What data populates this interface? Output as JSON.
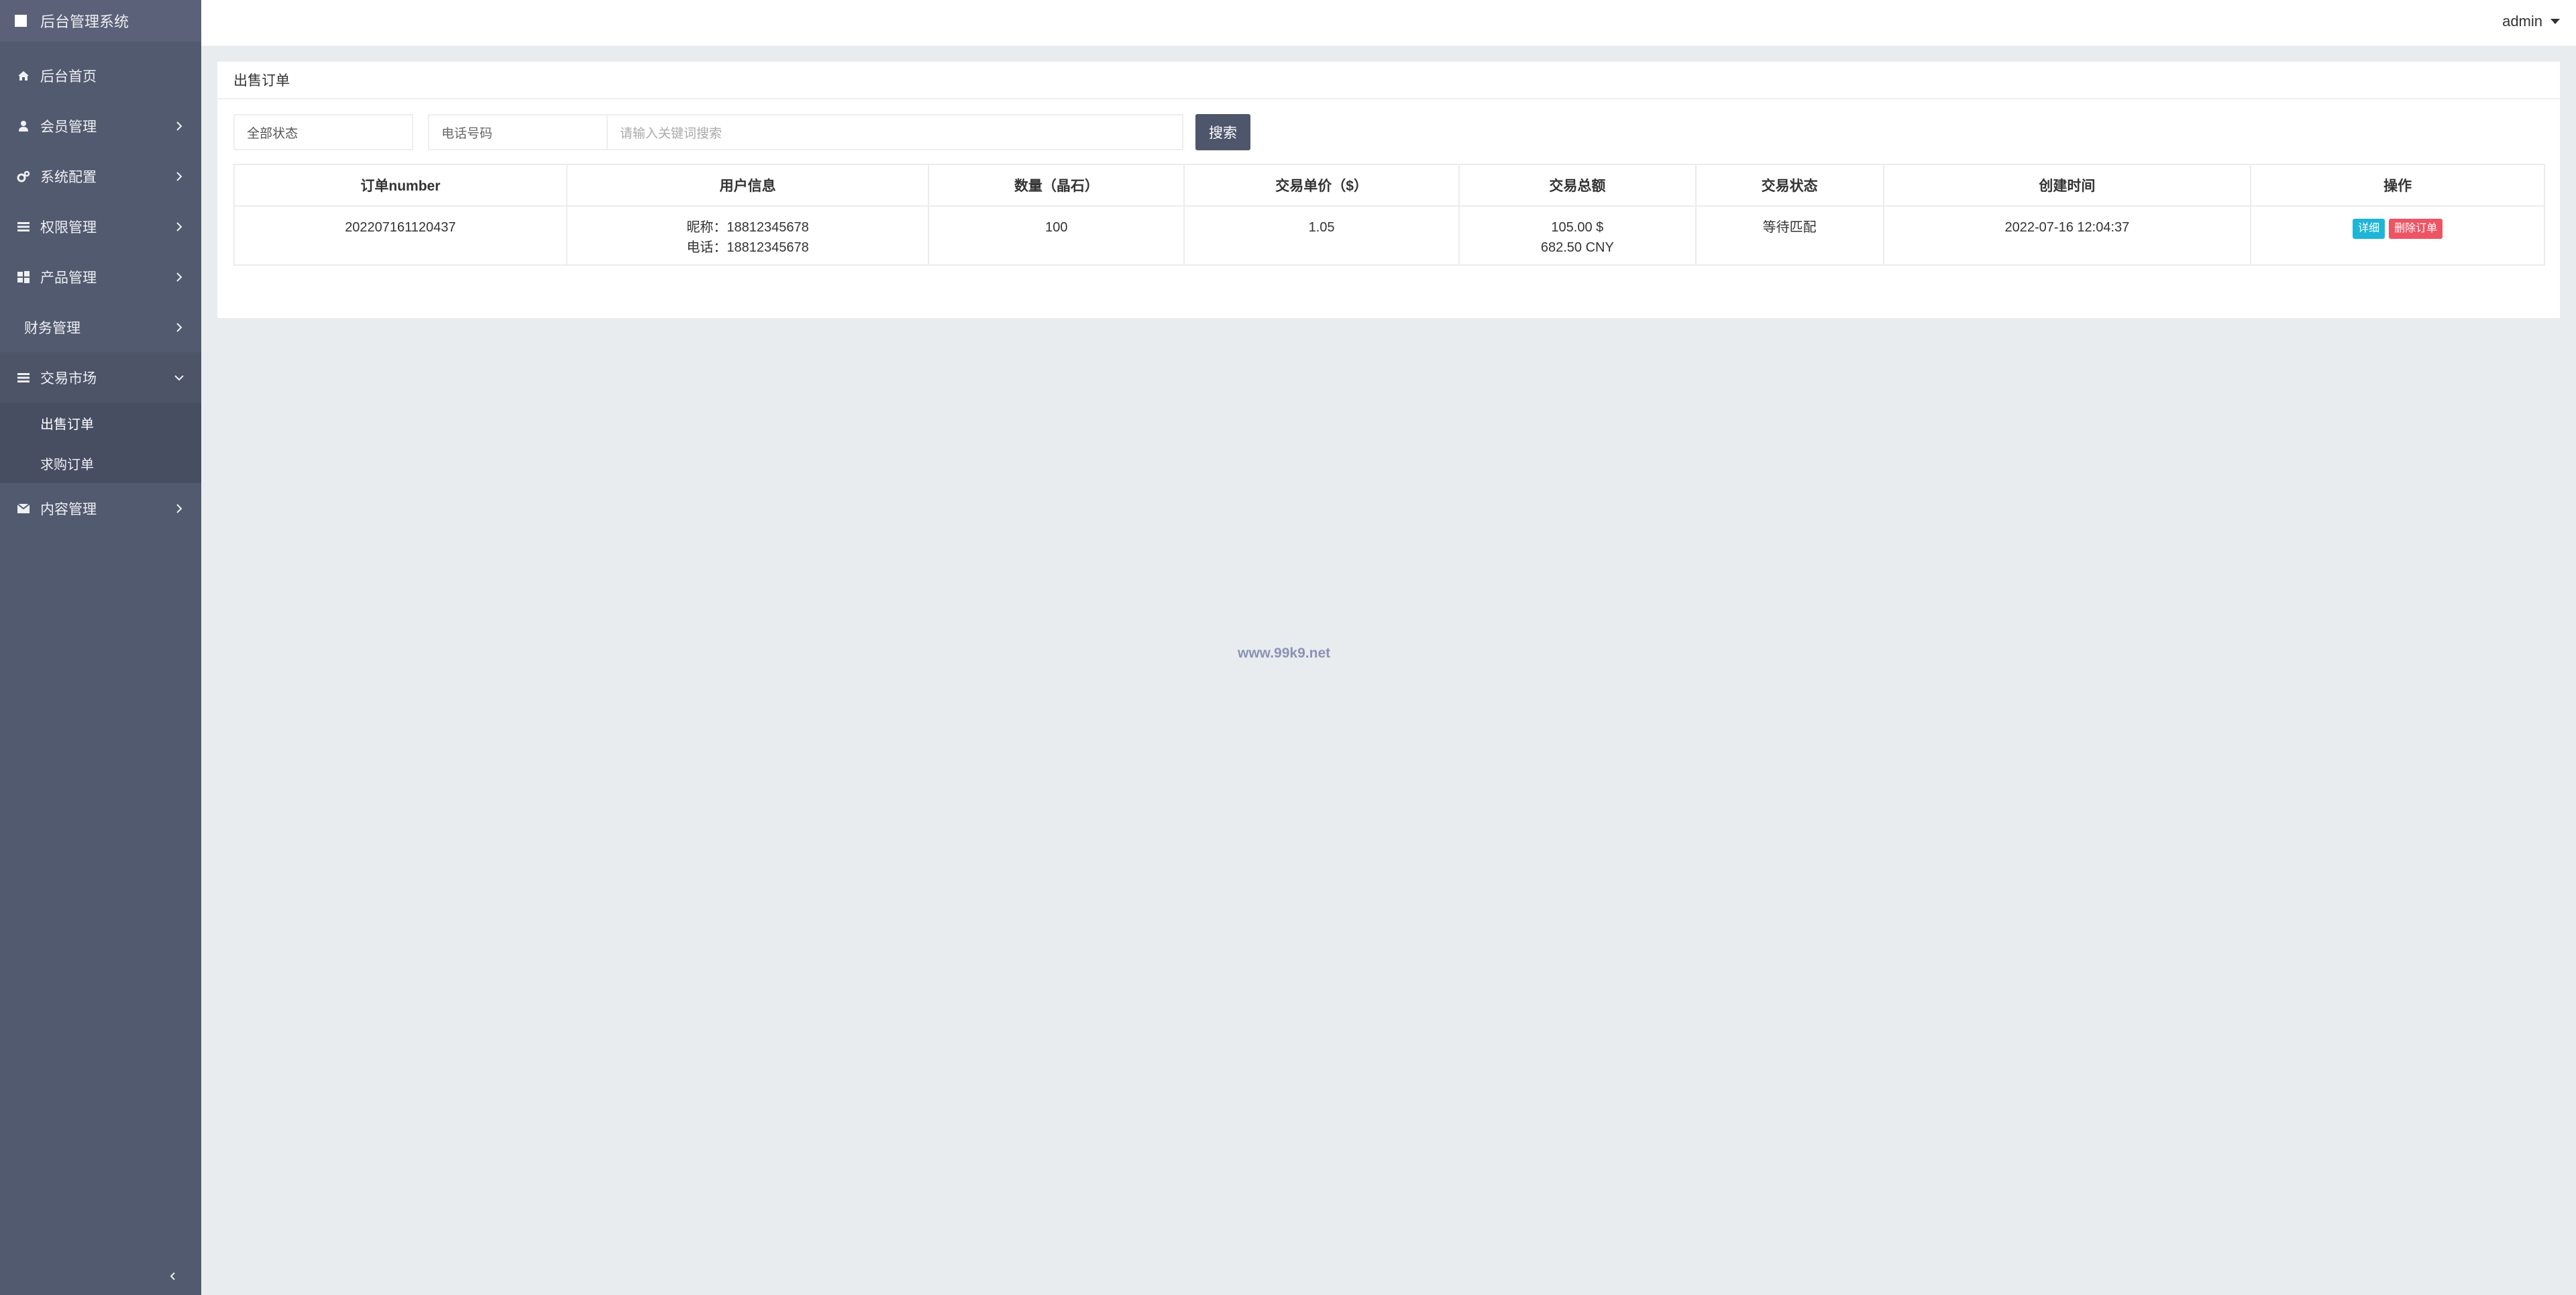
{
  "sidebar": {
    "brand": "后台管理系统",
    "items": [
      {
        "label": "后台首页",
        "icon": "home-icon"
      },
      {
        "label": "会员管理",
        "icon": "user-icon"
      },
      {
        "label": "系统配置",
        "icon": "cogs-icon"
      },
      {
        "label": "权限管理",
        "icon": "list-icon"
      },
      {
        "label": "产品管理",
        "icon": "windows-icon"
      },
      {
        "label": "财务管理",
        "icon": ""
      },
      {
        "label": "交易市场",
        "icon": "bars-icon",
        "expanded": true
      },
      {
        "label": "内容管理",
        "icon": "envelope-icon"
      }
    ],
    "trade_submenu": [
      {
        "label": "出售订单",
        "active": true
      },
      {
        "label": "求购订单",
        "active": false
      }
    ]
  },
  "topbar": {
    "user": "admin"
  },
  "panel": {
    "title": "出售订单",
    "filters": {
      "status_value": "全部状态",
      "phone_placeholder": "电话号码",
      "keyword_placeholder": "请输入关键词搜索",
      "search_label": "搜索"
    },
    "table": {
      "headers": [
        "订单number",
        "用户信息",
        "数量（晶石）",
        "交易单价（$）",
        "交易总额",
        "交易状态",
        "创建时间",
        "操作"
      ],
      "rows": [
        {
          "order_number": "202207161120437",
          "nickname": "昵称：18812345678",
          "phone": "电话：18812345678",
          "quantity": "100",
          "unit_price": "1.05",
          "total_usd": "105.00 $",
          "total_cny": "682.50 CNY",
          "status": "等待匹配",
          "created_at": "2022-07-16 12:04:37",
          "detail_label": "详细",
          "delete_label": "删除订单"
        }
      ]
    }
  },
  "watermark": "www.99k9.net",
  "colors": {
    "sidebar_bg": "#525a6f",
    "search_button": "#4e566c",
    "detail_button": "#1fb5d6",
    "delete_button": "#ed5565",
    "page_bg": "#e9ecef"
  }
}
